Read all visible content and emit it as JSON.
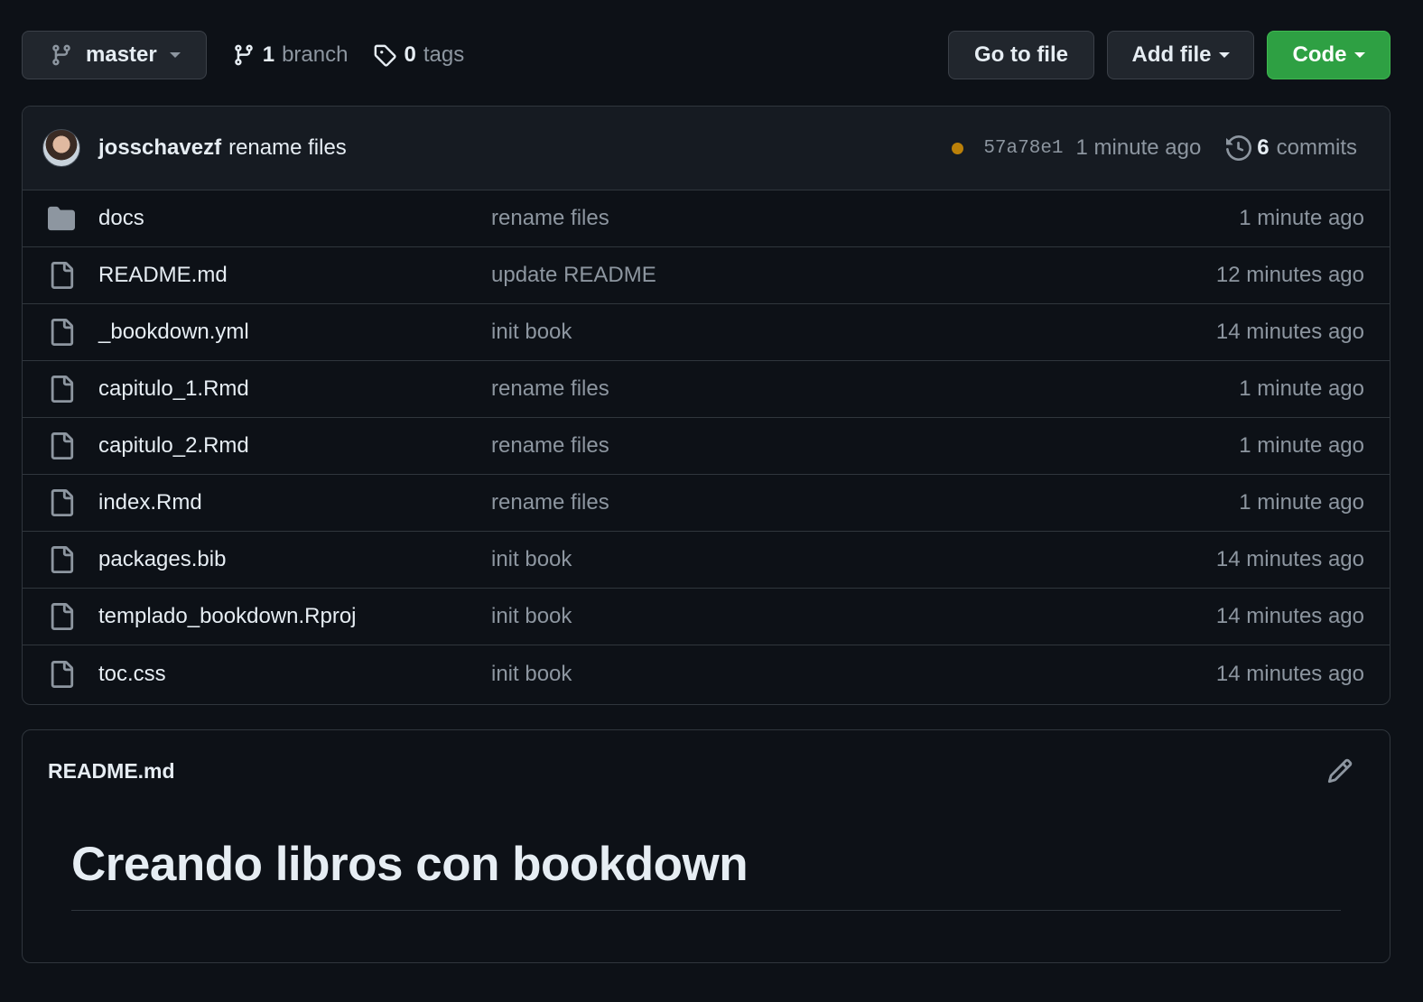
{
  "topbar": {
    "branch_button": {
      "label": "master",
      "icon": "git-branch-icon"
    },
    "branches": {
      "count": "1",
      "label": "branch",
      "icon": "git-branch-icon"
    },
    "tags": {
      "count": "0",
      "label": "tags",
      "icon": "tag-icon"
    },
    "go_to_file": "Go to file",
    "add_file": "Add file",
    "code": "Code"
  },
  "commit": {
    "author": "josschavezf",
    "message": "rename files",
    "status_color": "#bb8009",
    "sha": "57a78e1",
    "time": "1 minute ago",
    "commit_count": "6",
    "commits_label": "commits"
  },
  "files": [
    {
      "name": "docs",
      "type": "folder",
      "message": "rename files",
      "time": "1 minute ago"
    },
    {
      "name": "README.md",
      "type": "file",
      "message": "update README",
      "time": "12 minutes ago"
    },
    {
      "name": "_bookdown.yml",
      "type": "file",
      "message": "init book",
      "time": "14 minutes ago"
    },
    {
      "name": "capitulo_1.Rmd",
      "type": "file",
      "message": "rename files",
      "time": "1 minute ago"
    },
    {
      "name": "capitulo_2.Rmd",
      "type": "file",
      "message": "rename files",
      "time": "1 minute ago"
    },
    {
      "name": "index.Rmd",
      "type": "file",
      "message": "rename files",
      "time": "1 minute ago"
    },
    {
      "name": "packages.bib",
      "type": "file",
      "message": "init book",
      "time": "14 minutes ago"
    },
    {
      "name": "templado_bookdown.Rproj",
      "type": "file",
      "message": "init book",
      "time": "14 minutes ago"
    },
    {
      "name": "toc.css",
      "type": "file",
      "message": "init book",
      "time": "14 minutes ago"
    }
  ],
  "readme": {
    "filename": "README.md",
    "heading": "Creando libros con bookdown"
  },
  "colors": {
    "background": "#0d1117",
    "code_button": "#2ea043",
    "folder_icon": "#8d96a0"
  }
}
